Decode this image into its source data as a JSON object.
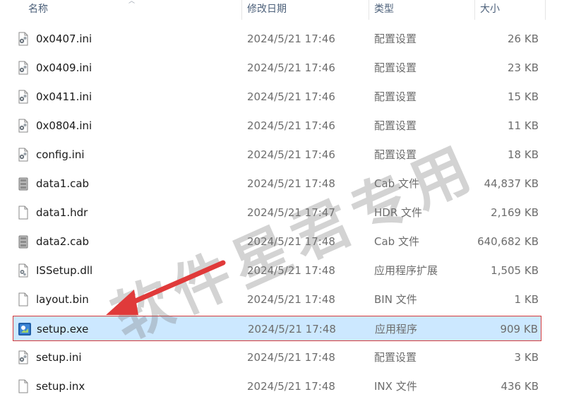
{
  "header": {
    "name": "名称",
    "modified": "修改日期",
    "type": "类型",
    "size": "大小"
  },
  "files": [
    {
      "name": "0x0407.ini",
      "modified": "2024/5/21 17:46",
      "type": "配置设置",
      "size": "26 KB",
      "icon": "settings-file-icon"
    },
    {
      "name": "0x0409.ini",
      "modified": "2024/5/21 17:46",
      "type": "配置设置",
      "size": "23 KB",
      "icon": "settings-file-icon"
    },
    {
      "name": "0x0411.ini",
      "modified": "2024/5/21 17:46",
      "type": "配置设置",
      "size": "15 KB",
      "icon": "settings-file-icon"
    },
    {
      "name": "0x0804.ini",
      "modified": "2024/5/21 17:46",
      "type": "配置设置",
      "size": "11 KB",
      "icon": "settings-file-icon"
    },
    {
      "name": "config.ini",
      "modified": "2024/5/21 17:46",
      "type": "配置设置",
      "size": "18 KB",
      "icon": "settings-file-icon"
    },
    {
      "name": "data1.cab",
      "modified": "2024/5/21 17:48",
      "type": "Cab 文件",
      "size": "44,837 KB",
      "icon": "cabinet-file-icon"
    },
    {
      "name": "data1.hdr",
      "modified": "2024/5/21 17:47",
      "type": "HDR 文件",
      "size": "2,169 KB",
      "icon": "blank-file-icon"
    },
    {
      "name": "data2.cab",
      "modified": "2024/5/21 17:48",
      "type": "Cab 文件",
      "size": "640,682 KB",
      "icon": "cabinet-file-icon"
    },
    {
      "name": "ISSetup.dll",
      "modified": "2024/5/21 17:48",
      "type": "应用程序扩展",
      "size": "1,505 KB",
      "icon": "dll-file-icon"
    },
    {
      "name": "layout.bin",
      "modified": "2024/5/21 17:48",
      "type": "BIN 文件",
      "size": "1 KB",
      "icon": "blank-file-icon"
    },
    {
      "name": "setup.exe",
      "modified": "2024/5/21 17:48",
      "type": "应用程序",
      "size": "909 KB",
      "icon": "installer-app-icon",
      "selected": true
    },
    {
      "name": "setup.ini",
      "modified": "2024/5/21 17:48",
      "type": "配置设置",
      "size": "3 KB",
      "icon": "settings-file-icon"
    },
    {
      "name": "setup.inx",
      "modified": "2024/5/21 17:48",
      "type": "INX 文件",
      "size": "436 KB",
      "icon": "blank-file-icon"
    }
  ],
  "watermark": "软件星君专用",
  "colors": {
    "selection": "#cce8ff",
    "highlight_box": "#d43b3b",
    "arrow": "#e03a3a",
    "header_text": "#4c607a"
  }
}
